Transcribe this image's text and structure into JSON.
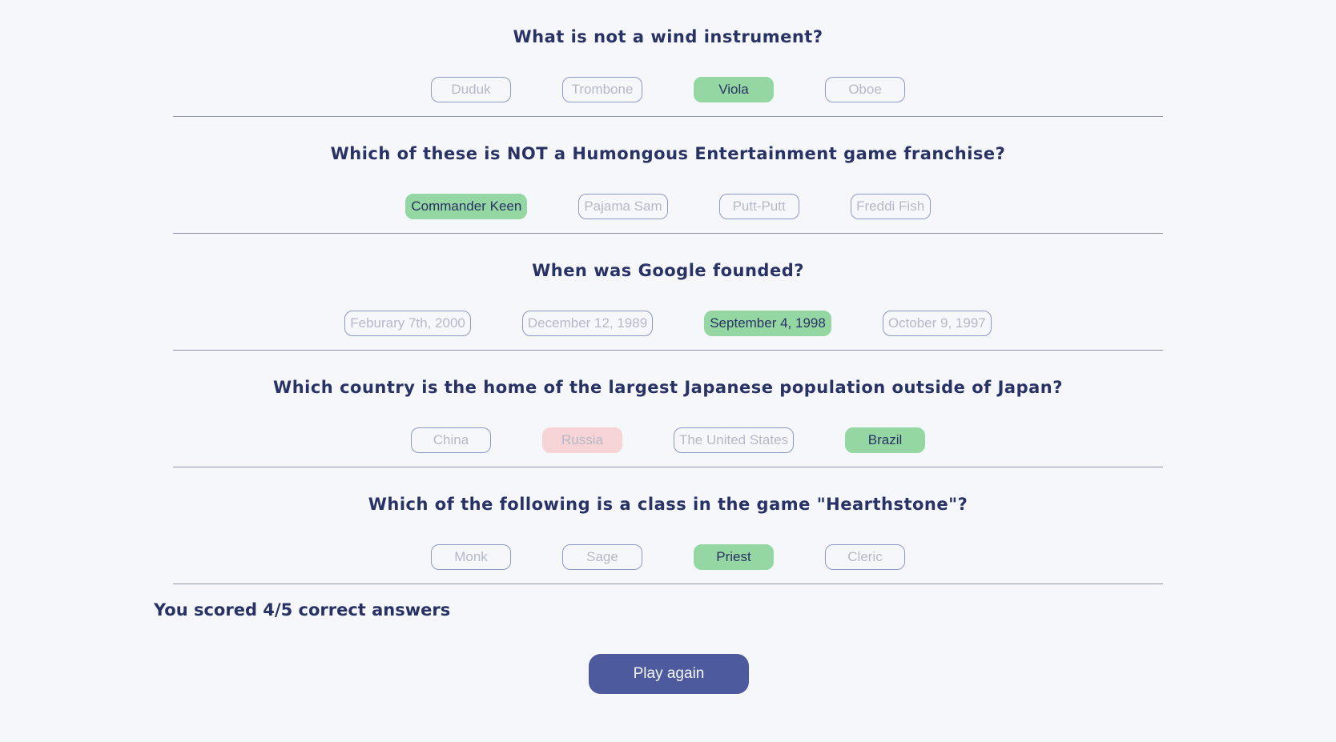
{
  "questions": [
    {
      "question": "What is not a wind instrument?",
      "answers": [
        {
          "label": "Duduk",
          "state": "neutral"
        },
        {
          "label": "Trombone",
          "state": "neutral"
        },
        {
          "label": "Viola",
          "state": "correct"
        },
        {
          "label": "Oboe",
          "state": "neutral"
        }
      ]
    },
    {
      "question": "Which of these is NOT a Humongous Entertainment game franchise?",
      "answers": [
        {
          "label": "Commander Keen",
          "state": "correct"
        },
        {
          "label": "Pajama Sam",
          "state": "neutral"
        },
        {
          "label": "Putt-Putt",
          "state": "neutral"
        },
        {
          "label": "Freddi Fish",
          "state": "neutral"
        }
      ]
    },
    {
      "question": "When was Google founded?",
      "answers": [
        {
          "label": "Feburary 7th, 2000",
          "state": "neutral"
        },
        {
          "label": "December 12, 1989",
          "state": "neutral"
        },
        {
          "label": "September 4, 1998",
          "state": "correct"
        },
        {
          "label": "October 9, 1997",
          "state": "neutral"
        }
      ]
    },
    {
      "question": "Which country is the home of the largest Japanese population outside of Japan?",
      "answers": [
        {
          "label": "China",
          "state": "neutral"
        },
        {
          "label": "Russia",
          "state": "wrong"
        },
        {
          "label": "The United States",
          "state": "neutral"
        },
        {
          "label": "Brazil",
          "state": "correct"
        }
      ]
    },
    {
      "question": "Which of the following is a class in the game \"Hearthstone\"?",
      "answers": [
        {
          "label": "Monk",
          "state": "neutral"
        },
        {
          "label": "Sage",
          "state": "neutral"
        },
        {
          "label": "Priest",
          "state": "correct"
        },
        {
          "label": "Cleric",
          "state": "neutral"
        }
      ]
    }
  ],
  "score_text": "You scored 4/5 correct answers",
  "play_again_label": "Play again",
  "colors": {
    "background": "#f5f7fb",
    "text": "#293264",
    "accent": "#4d5b9e",
    "correct": "#94d7a2",
    "wrong": "#f8bcbc"
  }
}
